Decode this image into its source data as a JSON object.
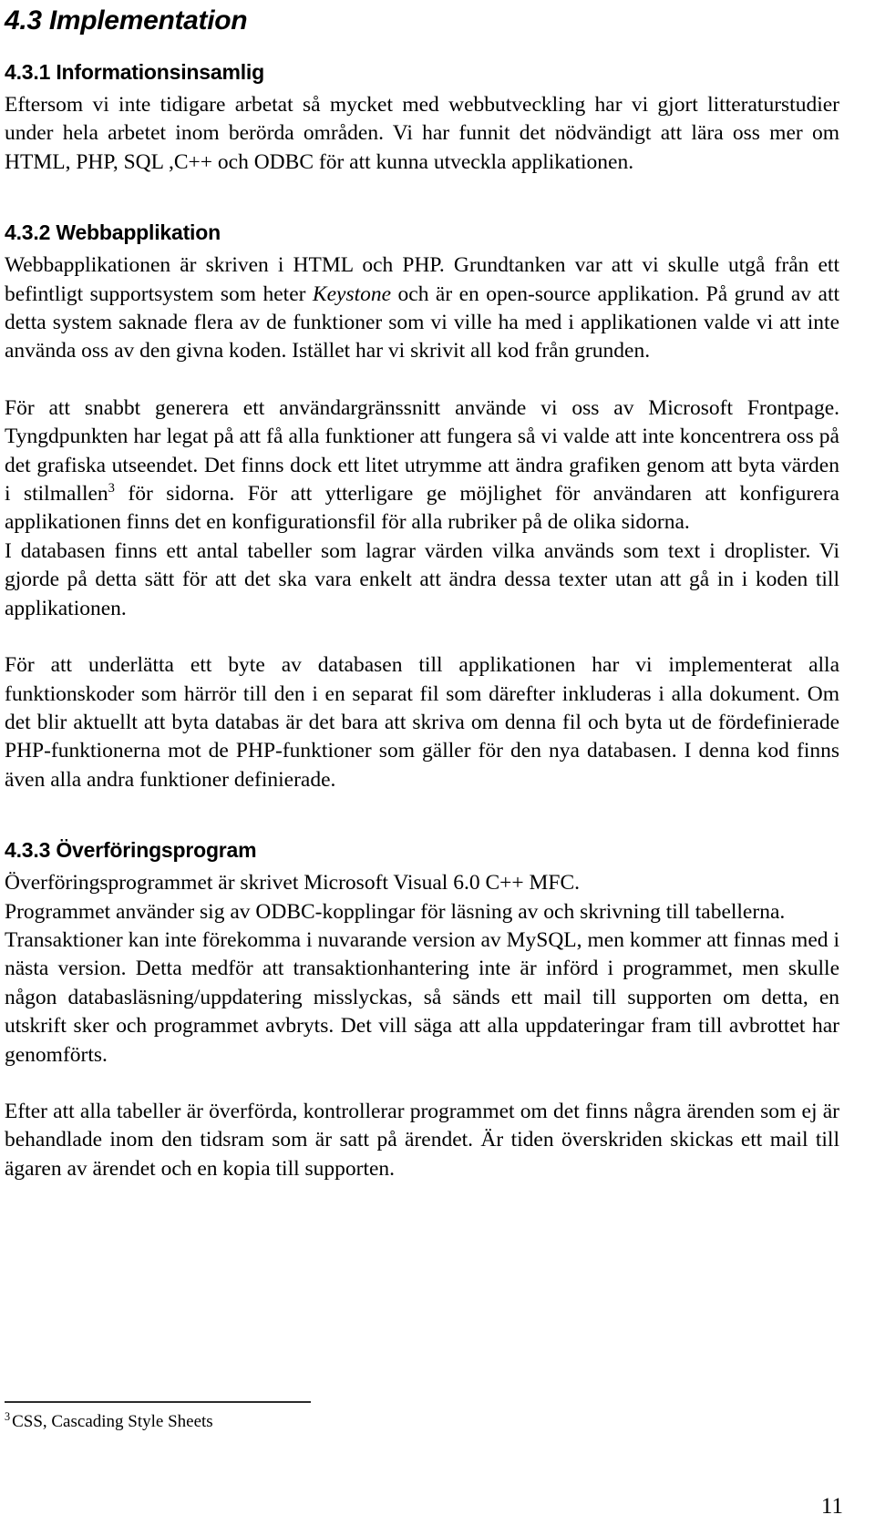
{
  "page": {
    "number": "11",
    "language": "sv"
  },
  "headings": {
    "section": "4.3 Implementation",
    "sub1": "4.3.1 Informationsinsamlig",
    "sub2": "4.3.2 Webbapplikation",
    "sub3": "4.3.3 Överföringsprogram"
  },
  "paragraphs": {
    "p1": "Eftersom vi inte tidigare arbetat så mycket med webbutveckling har vi gjort litteraturstudier under hela arbetet inom berörda områden. Vi har funnit det nödvändigt att lära oss mer om HTML, PHP, SQL ,C++ och ODBC för att kunna utveckla applikationen.",
    "p2_a": "Webbapplikationen är skriven i HTML och PHP. Grundtanken var att vi skulle utgå från ett befintligt supportsystem som heter ",
    "p2_italic": "Keystone",
    "p2_b": " och är en open-source applikation. På grund av att detta system saknade flera av de funktioner som vi ville ha med i applikationen valde vi att inte använda oss av den givna koden. Istället har vi skrivit all kod från grunden.",
    "p3_a": "För att snabbt generera ett användargränssnitt använde vi oss av Microsoft Frontpage. Tyngdpunkten har legat på att få alla funktioner att fungera så vi valde att inte koncentrera oss på det grafiska utseendet. Det finns dock ett litet utrymme att ändra grafiken genom att byta värden i stilmallen",
    "p3_sup": "3",
    "p3_b": " för sidorna. För att ytterligare ge möjlighet för användaren att konfigurera applikationen finns det en konfigurationsfil för alla rubriker på de olika sidorna.",
    "p4": "I databasen finns ett antal tabeller som lagrar värden vilka används som text i droplister.  Vi gjorde på detta sätt för att det ska vara enkelt att ändra dessa texter utan att gå in i koden till applikationen.",
    "p5": "För att underlätta ett byte av databasen till applikationen har vi implementerat alla funktionskoder som härrör till den i en separat fil som därefter inkluderas i alla dokument. Om det blir aktuellt att byta databas är det bara att skriva om denna fil och byta ut de fördefinierade PHP-funktionerna mot de PHP-funktioner som gäller för den nya databasen. I denna kod finns även alla andra funktioner definierade.",
    "p6": "Överföringsprogrammet är skrivet Microsoft Visual 6.0 C++ MFC.",
    "p7": "Programmet använder sig av ODBC-kopplingar för läsning av och skrivning till tabellerna.",
    "p8": "Transaktioner kan inte förekomma i nuvarande version av MySQL,  men kommer att finnas med i nästa version. Detta medför att transaktionhantering inte är införd i programmet, men skulle någon databasläsning/uppdatering misslyckas, så sänds ett mail till supporten om detta, en utskrift sker och programmet avbryts. Det vill säga att alla uppdateringar fram till avbrottet har genomförts.",
    "p9": "Efter att alla tabeller är överförda, kontrollerar programmet om det finns några ärenden som ej är behandlade inom den tidsram som är satt på ärendet. Är tiden överskriden skickas ett mail till ägaren av ärendet och en kopia till supporten."
  },
  "footnote": {
    "marker": "3",
    "text": "CSS, Cascading Style Sheets"
  }
}
